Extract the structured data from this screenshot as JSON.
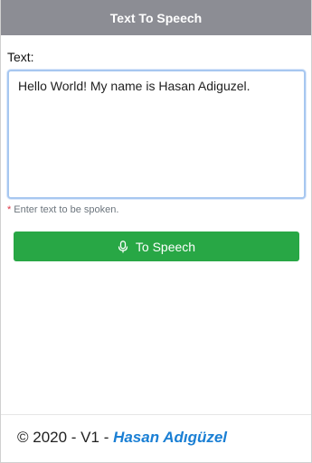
{
  "header": {
    "title": "Text To Speech"
  },
  "form": {
    "label": "Text:",
    "text_value": "Hello World! My name is Hasan Adiguzel.",
    "hint_star": "*",
    "hint_text": "Enter text to be spoken.",
    "button_label": "To Speech",
    "button_icon": "microphone-icon"
  },
  "footer": {
    "prefix": "© 2020 - V1 - ",
    "author": "Hasan Adıgüzel"
  },
  "colors": {
    "header_bg": "#8c8d94",
    "button_bg": "#28a745",
    "author_link": "#1a7fd4",
    "required_star": "#dc3545"
  }
}
